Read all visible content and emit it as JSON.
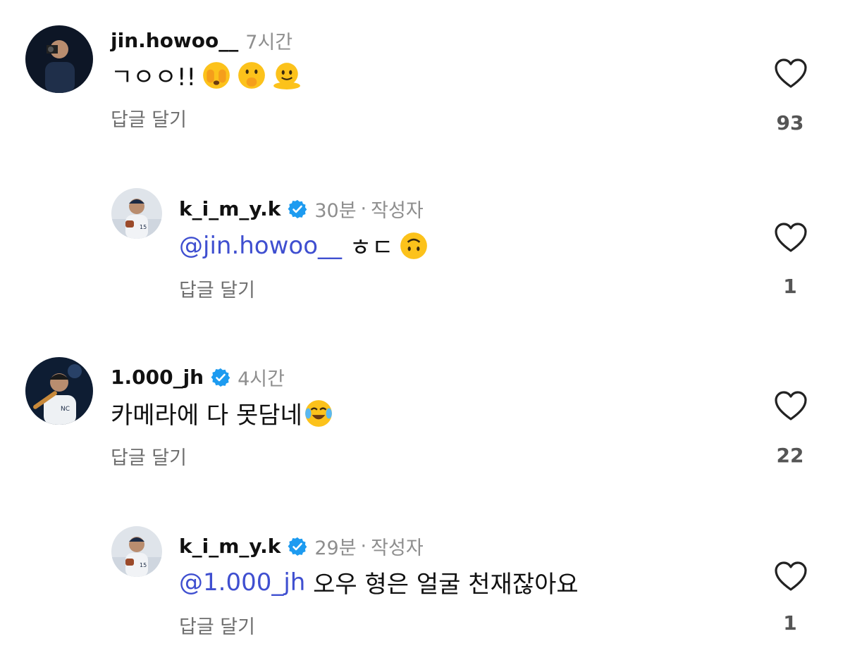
{
  "comments": [
    {
      "username": "jin.howoo__",
      "time": "7시간",
      "text": "ㄱㅇㅇ!!",
      "emojis": [
        "face-with-hands-over-eyes-emoji",
        "face-with-hand-over-mouth-emoji",
        "melting-face-emoji"
      ],
      "reply_label": "답글 달기",
      "likes": "93"
    },
    {
      "username": "k_i_m_y.k",
      "verified": true,
      "time": "30분",
      "separator": "·",
      "author_tag": "작성자",
      "mention": "@jin.howoo__",
      "text": " ㅎㄷ",
      "emojis": [
        "upside-down-face-emoji"
      ],
      "reply_label": "답글 달기",
      "likes": "1"
    },
    {
      "username": "1.000_jh",
      "verified": true,
      "time": "4시간",
      "text": "카메라에 다 못담네",
      "emojis": [
        "face-with-tears-of-joy-emoji"
      ],
      "reply_label": "답글 달기",
      "likes": "22"
    },
    {
      "username": "k_i_m_y.k",
      "verified": true,
      "time": "29분",
      "separator": "·",
      "author_tag": "작성자",
      "mention": "@1.000_jh",
      "text": " 오우 형은 얼굴 천재잖아요",
      "reply_label": "답글 달기",
      "likes": "1"
    }
  ],
  "colors": {
    "mention": "#3f4fd0",
    "verified": "#1d9bf0",
    "meta": "#8e8e8e"
  }
}
